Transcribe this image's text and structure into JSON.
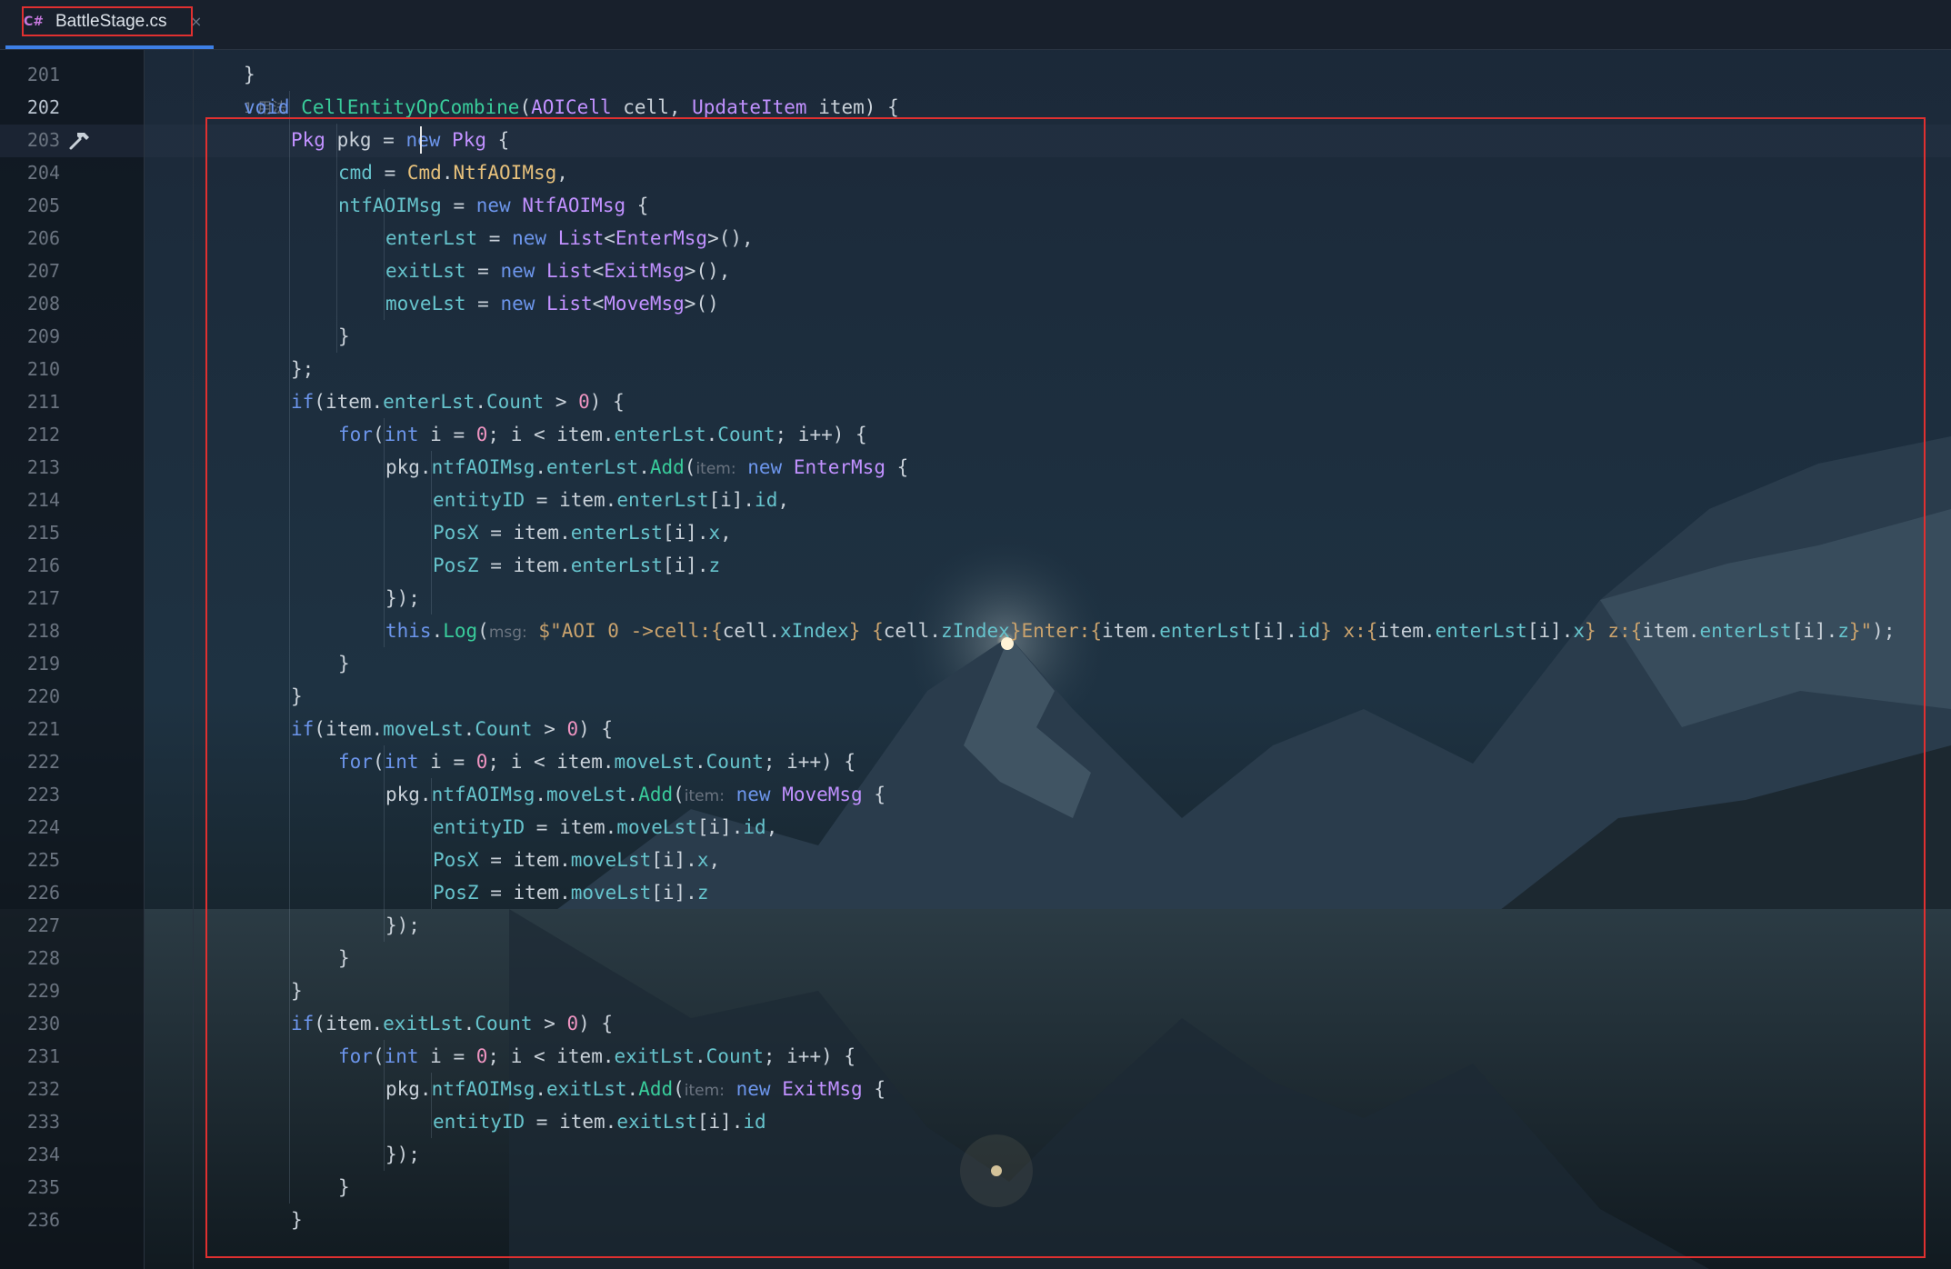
{
  "tab": {
    "lang_icon": "C#",
    "title": "BattleStage.cs",
    "close_glyph": "×",
    "active": true
  },
  "editor": {
    "usage_hint": "1 用法",
    "current_line": 202,
    "colors": {
      "keyword": "#6c95eb",
      "type": "#c191ff",
      "method": "#39cc9b",
      "field": "#66c3cc",
      "number": "#ed94c0",
      "string": "#c9a26d",
      "highlight_box": "#e03030",
      "tab_accent": "#3d7fe6"
    },
    "lines": [
      {
        "num": "201",
        "indent": 1,
        "tokens": [
          [
            "}",
            "p"
          ]
        ]
      },
      {
        "num": "202",
        "indent": 1,
        "tokens": [
          [
            "void",
            "kw"
          ],
          [
            " ",
            "p"
          ],
          [
            "CellEntityOpCombine",
            "fn"
          ],
          [
            "(",
            "p"
          ],
          [
            "AOICell",
            "ty"
          ],
          [
            " cell, ",
            "p"
          ],
          [
            "UpdateItem",
            "ty"
          ],
          [
            " item) {",
            "p"
          ]
        ]
      },
      {
        "num": "203",
        "indent": 2,
        "tokens": [
          [
            "Pkg",
            "ty"
          ],
          [
            " pkg = ",
            "p"
          ],
          [
            "new",
            "kw"
          ],
          [
            " ",
            "p"
          ],
          [
            "Pkg",
            "ty"
          ],
          [
            " {",
            "p"
          ]
        ]
      },
      {
        "num": "204",
        "indent": 3,
        "tokens": [
          [
            "cmd",
            "fd"
          ],
          [
            " = ",
            "p"
          ],
          [
            "Cmd",
            "en"
          ],
          [
            ".",
            "p"
          ],
          [
            "NtfAOIMsg",
            "en"
          ],
          [
            ",",
            "p"
          ]
        ]
      },
      {
        "num": "205",
        "indent": 3,
        "tokens": [
          [
            "ntfAOIMsg",
            "fd"
          ],
          [
            " = ",
            "p"
          ],
          [
            "new",
            "kw"
          ],
          [
            " ",
            "p"
          ],
          [
            "NtfAOIMsg",
            "ty"
          ],
          [
            " {",
            "p"
          ]
        ]
      },
      {
        "num": "206",
        "indent": 4,
        "tokens": [
          [
            "enterLst",
            "fd"
          ],
          [
            " = ",
            "p"
          ],
          [
            "new",
            "kw"
          ],
          [
            " ",
            "p"
          ],
          [
            "List",
            "ty"
          ],
          [
            "<",
            "p"
          ],
          [
            "EnterMsg",
            "ty"
          ],
          [
            ">(),",
            "p"
          ]
        ]
      },
      {
        "num": "207",
        "indent": 4,
        "tokens": [
          [
            "exitLst",
            "fd"
          ],
          [
            " = ",
            "p"
          ],
          [
            "new",
            "kw"
          ],
          [
            " ",
            "p"
          ],
          [
            "List",
            "ty"
          ],
          [
            "<",
            "p"
          ],
          [
            "ExitMsg",
            "ty"
          ],
          [
            ">(),",
            "p"
          ]
        ]
      },
      {
        "num": "208",
        "indent": 4,
        "tokens": [
          [
            "moveLst",
            "fd"
          ],
          [
            " = ",
            "p"
          ],
          [
            "new",
            "kw"
          ],
          [
            " ",
            "p"
          ],
          [
            "List",
            "ty"
          ],
          [
            "<",
            "p"
          ],
          [
            "MoveMsg",
            "ty"
          ],
          [
            ">()",
            "p"
          ]
        ]
      },
      {
        "num": "209",
        "indent": 3,
        "tokens": [
          [
            "}",
            "p"
          ]
        ]
      },
      {
        "num": "210",
        "indent": 2,
        "tokens": [
          [
            "};",
            "p"
          ]
        ]
      },
      {
        "num": "211",
        "indent": 2,
        "tokens": [
          [
            "if",
            "kw"
          ],
          [
            "(item.",
            "p"
          ],
          [
            "enterLst",
            "fd"
          ],
          [
            ".",
            "p"
          ],
          [
            "Count",
            "fd"
          ],
          [
            " > ",
            "p"
          ],
          [
            "0",
            "nm"
          ],
          [
            ") {",
            "p"
          ]
        ]
      },
      {
        "num": "212",
        "indent": 3,
        "tokens": [
          [
            "for",
            "kw"
          ],
          [
            "(",
            "p"
          ],
          [
            "int",
            "kw"
          ],
          [
            " i = ",
            "p"
          ],
          [
            "0",
            "nm"
          ],
          [
            "; i < item.",
            "p"
          ],
          [
            "enterLst",
            "fd"
          ],
          [
            ".",
            "p"
          ],
          [
            "Count",
            "fd"
          ],
          [
            "; i++) {",
            "p"
          ]
        ]
      },
      {
        "num": "213",
        "indent": 4,
        "tokens": [
          [
            "pkg.",
            "p"
          ],
          [
            "ntfAOIMsg",
            "fd"
          ],
          [
            ".",
            "p"
          ],
          [
            "enterLst",
            "fd"
          ],
          [
            ".",
            "p"
          ],
          [
            "Add",
            "fn"
          ],
          [
            "(",
            "p"
          ],
          [
            "item:",
            "hint"
          ],
          [
            " ",
            "p"
          ],
          [
            "new",
            "kw"
          ],
          [
            " ",
            "p"
          ],
          [
            "EnterMsg",
            "ty"
          ],
          [
            " {",
            "p"
          ]
        ]
      },
      {
        "num": "214",
        "indent": 5,
        "tokens": [
          [
            "entityID",
            "fd"
          ],
          [
            " = item.",
            "p"
          ],
          [
            "enterLst",
            "fd"
          ],
          [
            "[i].",
            "p"
          ],
          [
            "id",
            "fd"
          ],
          [
            ",",
            "p"
          ]
        ]
      },
      {
        "num": "215",
        "indent": 5,
        "tokens": [
          [
            "PosX",
            "fd"
          ],
          [
            " = item.",
            "p"
          ],
          [
            "enterLst",
            "fd"
          ],
          [
            "[i].",
            "p"
          ],
          [
            "x",
            "fd"
          ],
          [
            ",",
            "p"
          ]
        ]
      },
      {
        "num": "216",
        "indent": 5,
        "tokens": [
          [
            "PosZ",
            "fd"
          ],
          [
            " = item.",
            "p"
          ],
          [
            "enterLst",
            "fd"
          ],
          [
            "[i].",
            "p"
          ],
          [
            "z",
            "fd"
          ]
        ]
      },
      {
        "num": "217",
        "indent": 4,
        "tokens": [
          [
            "});",
            "p"
          ]
        ]
      },
      {
        "num": "218",
        "indent": 4,
        "tokens": [
          [
            "this",
            "kw"
          ],
          [
            ".",
            "p"
          ],
          [
            "Log",
            "fn"
          ],
          [
            "(",
            "p"
          ],
          [
            "msg:",
            "hint"
          ],
          [
            " ",
            "p"
          ],
          [
            "$\"AOI 0 ->cell:{",
            "st"
          ],
          [
            "cell.",
            "p"
          ],
          [
            "xIndex",
            "fd"
          ],
          [
            "} {",
            "st"
          ],
          [
            "cell.",
            "p"
          ],
          [
            "zIndex",
            "fd"
          ],
          [
            "}Enter:{",
            "st"
          ],
          [
            "item.",
            "p"
          ],
          [
            "enterLst",
            "fd"
          ],
          [
            "[i].",
            "p"
          ],
          [
            "id",
            "fd"
          ],
          [
            "} x:{",
            "st"
          ],
          [
            "item.",
            "p"
          ],
          [
            "enterLst",
            "fd"
          ],
          [
            "[i].",
            "p"
          ],
          [
            "x",
            "fd"
          ],
          [
            "} z:{",
            "st"
          ],
          [
            "item.",
            "p"
          ],
          [
            "enterLst",
            "fd"
          ],
          [
            "[i].",
            "p"
          ],
          [
            "z",
            "fd"
          ],
          [
            "}\"",
            "st"
          ],
          [
            ");",
            "p"
          ]
        ]
      },
      {
        "num": "219",
        "indent": 3,
        "tokens": [
          [
            "}",
            "p"
          ]
        ]
      },
      {
        "num": "220",
        "indent": 2,
        "tokens": [
          [
            "}",
            "p"
          ]
        ]
      },
      {
        "num": "221",
        "indent": 2,
        "tokens": [
          [
            "if",
            "kw"
          ],
          [
            "(item.",
            "p"
          ],
          [
            "moveLst",
            "fd"
          ],
          [
            ".",
            "p"
          ],
          [
            "Count",
            "fd"
          ],
          [
            " > ",
            "p"
          ],
          [
            "0",
            "nm"
          ],
          [
            ") {",
            "p"
          ]
        ]
      },
      {
        "num": "222",
        "indent": 3,
        "tokens": [
          [
            "for",
            "kw"
          ],
          [
            "(",
            "p"
          ],
          [
            "int",
            "kw"
          ],
          [
            " i = ",
            "p"
          ],
          [
            "0",
            "nm"
          ],
          [
            "; i < item.",
            "p"
          ],
          [
            "moveLst",
            "fd"
          ],
          [
            ".",
            "p"
          ],
          [
            "Count",
            "fd"
          ],
          [
            "; i++) {",
            "p"
          ]
        ]
      },
      {
        "num": "223",
        "indent": 4,
        "tokens": [
          [
            "pkg.",
            "p"
          ],
          [
            "ntfAOIMsg",
            "fd"
          ],
          [
            ".",
            "p"
          ],
          [
            "moveLst",
            "fd"
          ],
          [
            ".",
            "p"
          ],
          [
            "Add",
            "fn"
          ],
          [
            "(",
            "p"
          ],
          [
            "item:",
            "hint"
          ],
          [
            " ",
            "p"
          ],
          [
            "new",
            "kw"
          ],
          [
            " ",
            "p"
          ],
          [
            "MoveMsg",
            "ty"
          ],
          [
            " {",
            "p"
          ]
        ]
      },
      {
        "num": "224",
        "indent": 5,
        "tokens": [
          [
            "entityID",
            "fd"
          ],
          [
            " = item.",
            "p"
          ],
          [
            "moveLst",
            "fd"
          ],
          [
            "[i].",
            "p"
          ],
          [
            "id",
            "fd"
          ],
          [
            ",",
            "p"
          ]
        ]
      },
      {
        "num": "225",
        "indent": 5,
        "tokens": [
          [
            "PosX",
            "fd"
          ],
          [
            " = item.",
            "p"
          ],
          [
            "moveLst",
            "fd"
          ],
          [
            "[i].",
            "p"
          ],
          [
            "x",
            "fd"
          ],
          [
            ",",
            "p"
          ]
        ]
      },
      {
        "num": "226",
        "indent": 5,
        "tokens": [
          [
            "PosZ",
            "fd"
          ],
          [
            " = item.",
            "p"
          ],
          [
            "moveLst",
            "fd"
          ],
          [
            "[i].",
            "p"
          ],
          [
            "z",
            "fd"
          ]
        ]
      },
      {
        "num": "227",
        "indent": 4,
        "tokens": [
          [
            "});",
            "p"
          ]
        ]
      },
      {
        "num": "228",
        "indent": 3,
        "tokens": [
          [
            "}",
            "p"
          ]
        ]
      },
      {
        "num": "229",
        "indent": 2,
        "tokens": [
          [
            "}",
            "p"
          ]
        ]
      },
      {
        "num": "230",
        "indent": 2,
        "tokens": [
          [
            "if",
            "kw"
          ],
          [
            "(item.",
            "p"
          ],
          [
            "exitLst",
            "fd"
          ],
          [
            ".",
            "p"
          ],
          [
            "Count",
            "fd"
          ],
          [
            " > ",
            "p"
          ],
          [
            "0",
            "nm"
          ],
          [
            ") {",
            "p"
          ]
        ]
      },
      {
        "num": "231",
        "indent": 3,
        "tokens": [
          [
            "for",
            "kw"
          ],
          [
            "(",
            "p"
          ],
          [
            "int",
            "kw"
          ],
          [
            " i = ",
            "p"
          ],
          [
            "0",
            "nm"
          ],
          [
            "; i < item.",
            "p"
          ],
          [
            "exitLst",
            "fd"
          ],
          [
            ".",
            "p"
          ],
          [
            "Count",
            "fd"
          ],
          [
            "; i++) {",
            "p"
          ]
        ]
      },
      {
        "num": "232",
        "indent": 4,
        "tokens": [
          [
            "pkg.",
            "p"
          ],
          [
            "ntfAOIMsg",
            "fd"
          ],
          [
            ".",
            "p"
          ],
          [
            "exitLst",
            "fd"
          ],
          [
            ".",
            "p"
          ],
          [
            "Add",
            "fn"
          ],
          [
            "(",
            "p"
          ],
          [
            "item:",
            "hint"
          ],
          [
            " ",
            "p"
          ],
          [
            "new",
            "kw"
          ],
          [
            " ",
            "p"
          ],
          [
            "ExitMsg",
            "ty"
          ],
          [
            " {",
            "p"
          ]
        ]
      },
      {
        "num": "233",
        "indent": 5,
        "tokens": [
          [
            "entityID",
            "fd"
          ],
          [
            " = item.",
            "p"
          ],
          [
            "exitLst",
            "fd"
          ],
          [
            "[i].",
            "p"
          ],
          [
            "id",
            "fd"
          ]
        ]
      },
      {
        "num": "234",
        "indent": 4,
        "tokens": [
          [
            "});",
            "p"
          ]
        ]
      },
      {
        "num": "235",
        "indent": 3,
        "tokens": [
          [
            "}",
            "p"
          ]
        ]
      },
      {
        "num": "236",
        "indent": 2,
        "tokens": [
          [
            "}",
            "p"
          ]
        ]
      }
    ]
  }
}
